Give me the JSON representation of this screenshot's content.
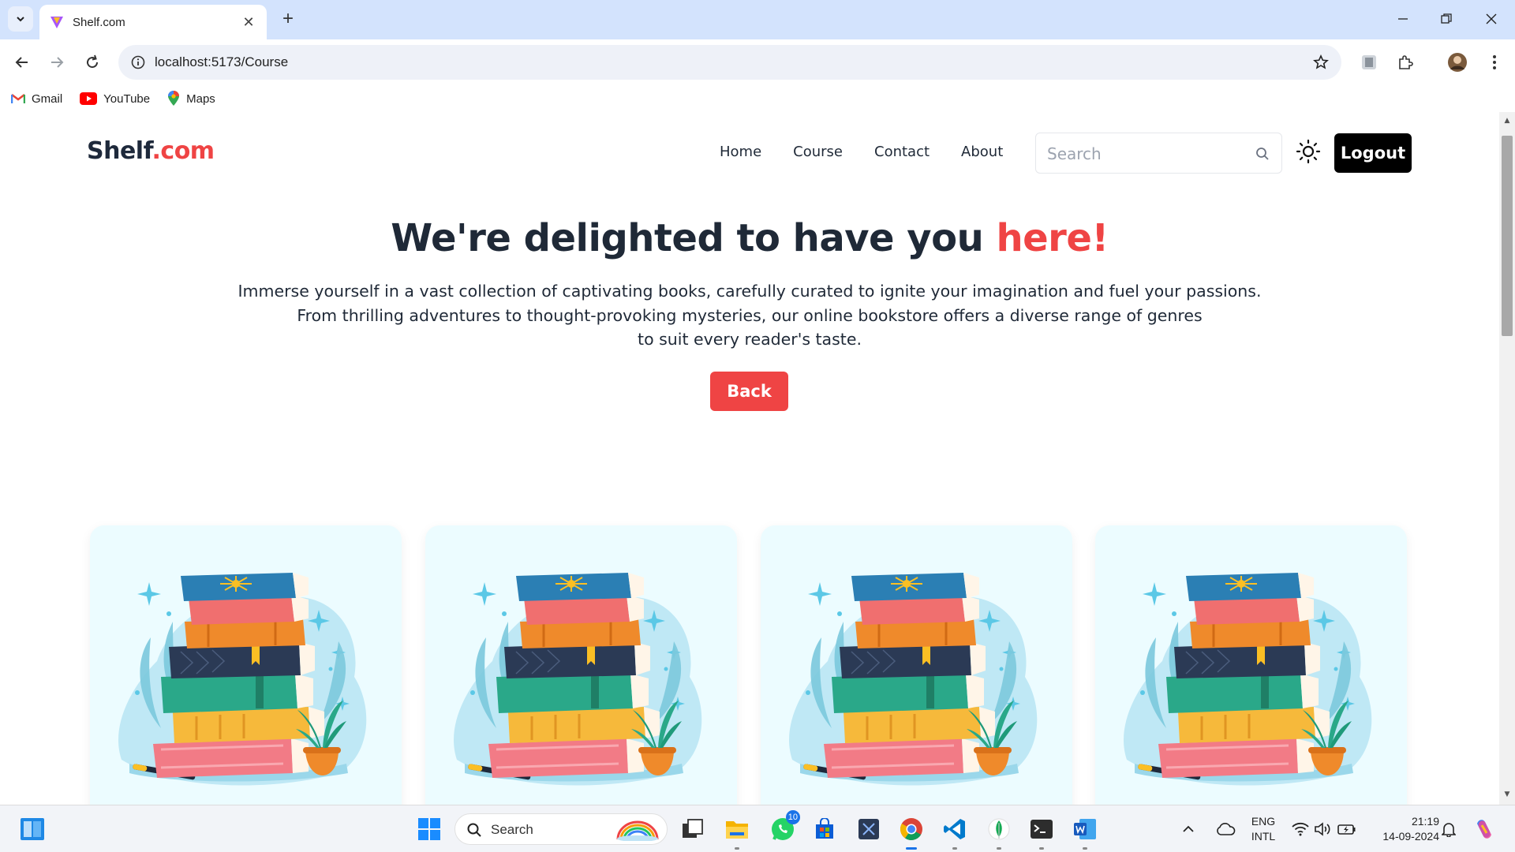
{
  "browser": {
    "tab_title": "Shelf.com",
    "url": "localhost:5173/Course",
    "bookmarks": [
      {
        "label": "Gmail",
        "icon": "gmail-icon"
      },
      {
        "label": "YouTube",
        "icon": "youtube-icon"
      },
      {
        "label": "Maps",
        "icon": "maps-icon"
      }
    ]
  },
  "site": {
    "logo_main": "Shelf",
    "logo_accent": ".com",
    "nav": [
      "Home",
      "Course",
      "Contact",
      "About"
    ],
    "search_placeholder": "Search",
    "logout_label": "Logout",
    "accent_color": "#ef4444"
  },
  "hero": {
    "title_main": "We're delighted to have you ",
    "title_accent": "here!",
    "description_lines": [
      "Immerse yourself in a vast collection of captivating books, carefully curated to ignite your imagination and fuel your passions.",
      "From thrilling adventures to thought-provoking mysteries, our online bookstore offers a diverse range of genres",
      "to suit every reader's taste."
    ],
    "back_label": "Back"
  },
  "cards": [
    {
      "image": "book-stack-illustration"
    },
    {
      "image": "book-stack-illustration"
    },
    {
      "image": "book-stack-illustration"
    },
    {
      "image": "book-stack-illustration"
    }
  ],
  "taskbar": {
    "search_label": "Search",
    "whatsapp_badge": "10",
    "lang_line1": "ENG",
    "lang_line2": "INTL",
    "time": "21:19",
    "date": "14-09-2024"
  }
}
